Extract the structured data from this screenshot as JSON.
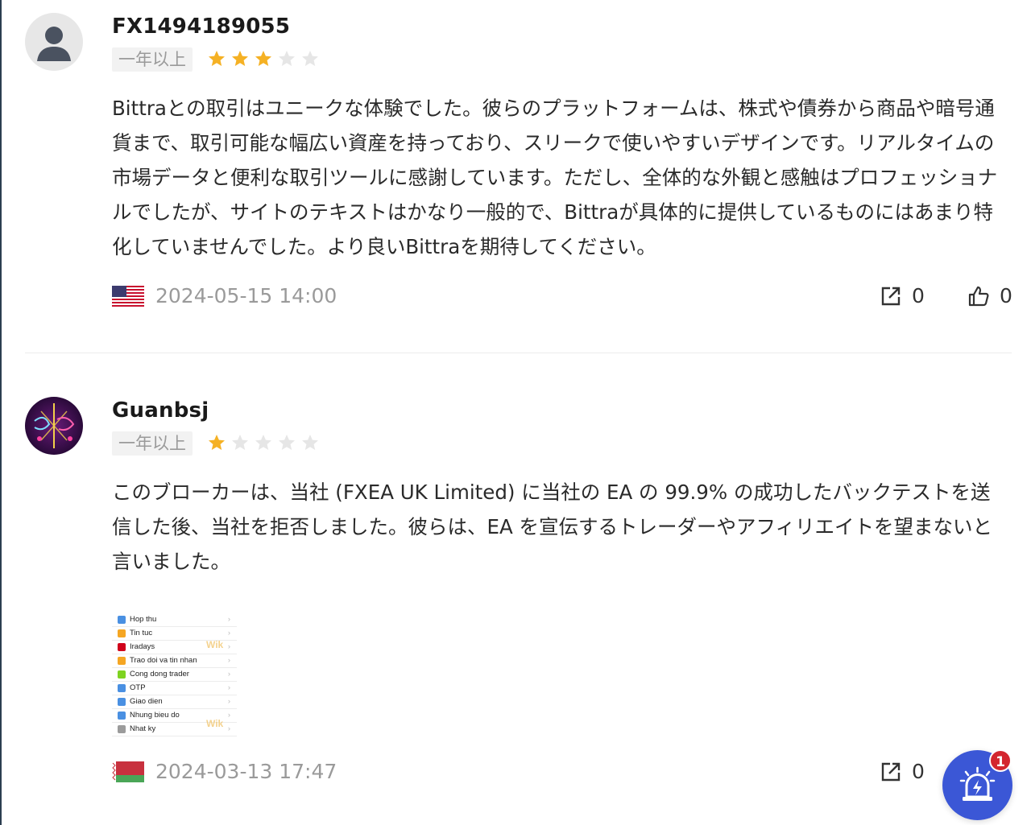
{
  "reviews": [
    {
      "username": "FX1494189055",
      "tenure": "一年以上",
      "rating": 3,
      "content": "Bittraとの取引はユニークな体験でした。彼らのプラットフォームは、株式や債券から商品や暗号通貨まで、取引可能な幅広い資産を持っており、スリークで使いやすいデザインです。リアルタイムの市場データと便利な取引ツールに感謝しています。ただし、全体的な外観と感触はプロフェッショナルでしたが、サイトのテキストはかなり一般的で、Bittraが具体的に提供しているものにはあまり特化していませんでした。より良いBittraを期待してください。",
      "date": "2024-05-15 14:00",
      "flag_icon": "us-flag-icon",
      "share_count": "0",
      "like_count": "0"
    },
    {
      "username": "Guanbsj",
      "tenure": "一年以上",
      "rating": 1,
      "content": "このブローカーは、当社 (FXEA UK Limited) に当社の EA の 99.9% の成功したバックテストを送信した後、当社を拒否しました。彼らは、EA を宣伝するトレーダーやアフィリエイトを望まないと言いました。",
      "date": "2024-03-13 17:47",
      "flag_icon": "belarus-flag-icon",
      "share_count": "0",
      "attachment": {
        "rows": [
          "Hop thu",
          "Tin tuc",
          "Iradays",
          "Trao doi va tin nhan",
          "Cong dong trader",
          "OTP",
          "Giao dien",
          "Nhung bieu do",
          "Nhat ky"
        ],
        "watermark": "Wik"
      }
    }
  ],
  "notification": {
    "badge": "1",
    "icon": "alarm-bell-icon"
  },
  "colors": {
    "star_filled": "#f5b124",
    "star_empty": "#e6e6e6",
    "fab": "#3b57d6",
    "badge": "#d3262f"
  }
}
